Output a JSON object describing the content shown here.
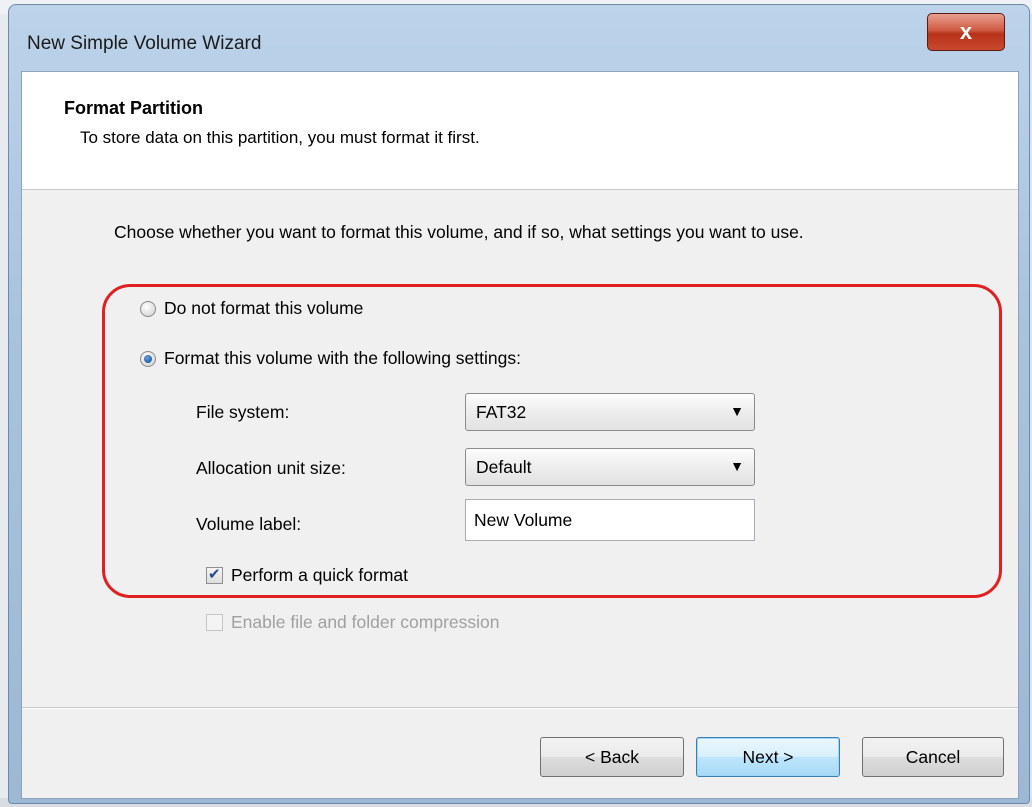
{
  "window": {
    "title": "New Simple Volume Wizard",
    "close_label": "x"
  },
  "header": {
    "title": "Format Partition",
    "subtitle": "To store data on this partition, you must format it first."
  },
  "instruction": "Choose whether you want to format this volume, and if so, what settings you want to use.",
  "options": {
    "no_format_label": "Do not format this volume",
    "no_format_selected": false,
    "format_label": "Format this volume with the following settings:",
    "format_selected": true
  },
  "settings": {
    "file_system_label": "File system:",
    "file_system_value": "FAT32",
    "allocation_label": "Allocation unit size:",
    "allocation_value": "Default",
    "volume_label_label": "Volume label:",
    "volume_label_value": "New Volume",
    "quick_format_label": "Perform a quick format",
    "quick_format_checked": true,
    "compression_label": "Enable file and folder compression",
    "compression_checked": false,
    "compression_enabled": false
  },
  "buttons": {
    "back": "< Back",
    "next": "Next >",
    "cancel": "Cancel"
  },
  "colors": {
    "highlight_border": "#e02020",
    "default_button_border": "#3c7fb1"
  }
}
